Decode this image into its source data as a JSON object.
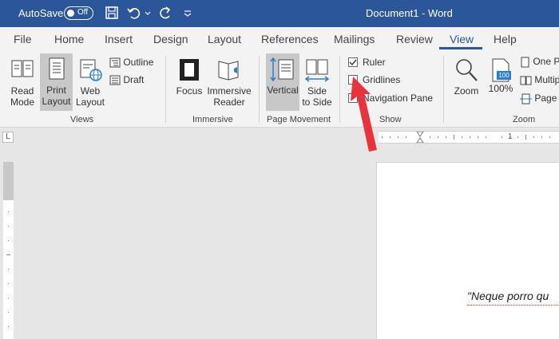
{
  "titlebar": {
    "autosave_label": "AutoSave",
    "autosave_state": "Off",
    "document_title": "Document1 - Word"
  },
  "tabs": [
    "File",
    "Home",
    "Insert",
    "Design",
    "Layout",
    "References",
    "Mailings",
    "Review",
    "View",
    "Help"
  ],
  "active_tab": "View",
  "ribbon": {
    "views": {
      "label": "Views",
      "read_mode": [
        "Read",
        "Mode"
      ],
      "print_layout": [
        "Print",
        "Layout"
      ],
      "web_layout": [
        "Web",
        "Layout"
      ],
      "outline": "Outline",
      "draft": "Draft"
    },
    "immersive": {
      "label": "Immersive",
      "focus": "Focus",
      "immersive_reader": [
        "Immersive",
        "Reader"
      ]
    },
    "page_movement": {
      "label": "Page Movement",
      "vertical": "Vertical",
      "side_to_side": [
        "Side",
        "to Side"
      ]
    },
    "show": {
      "label": "Show",
      "ruler": "Ruler",
      "ruler_checked": true,
      "gridlines": "Gridlines",
      "navigation_pane": "Navigation Pane"
    },
    "zoom": {
      "label": "Zoom",
      "zoom": "Zoom",
      "hundred": "100%",
      "hundred_badge": "100",
      "one_page": "One P",
      "multiple_pages": "Multip",
      "page_width": "Page W"
    }
  },
  "ruler": {
    "corner_glyph": "L",
    "tick_label": "1"
  },
  "document": {
    "text": "\"Neque porro qu"
  },
  "colors": {
    "titlebar": "#2b579a",
    "arrow": "#e8323c"
  }
}
